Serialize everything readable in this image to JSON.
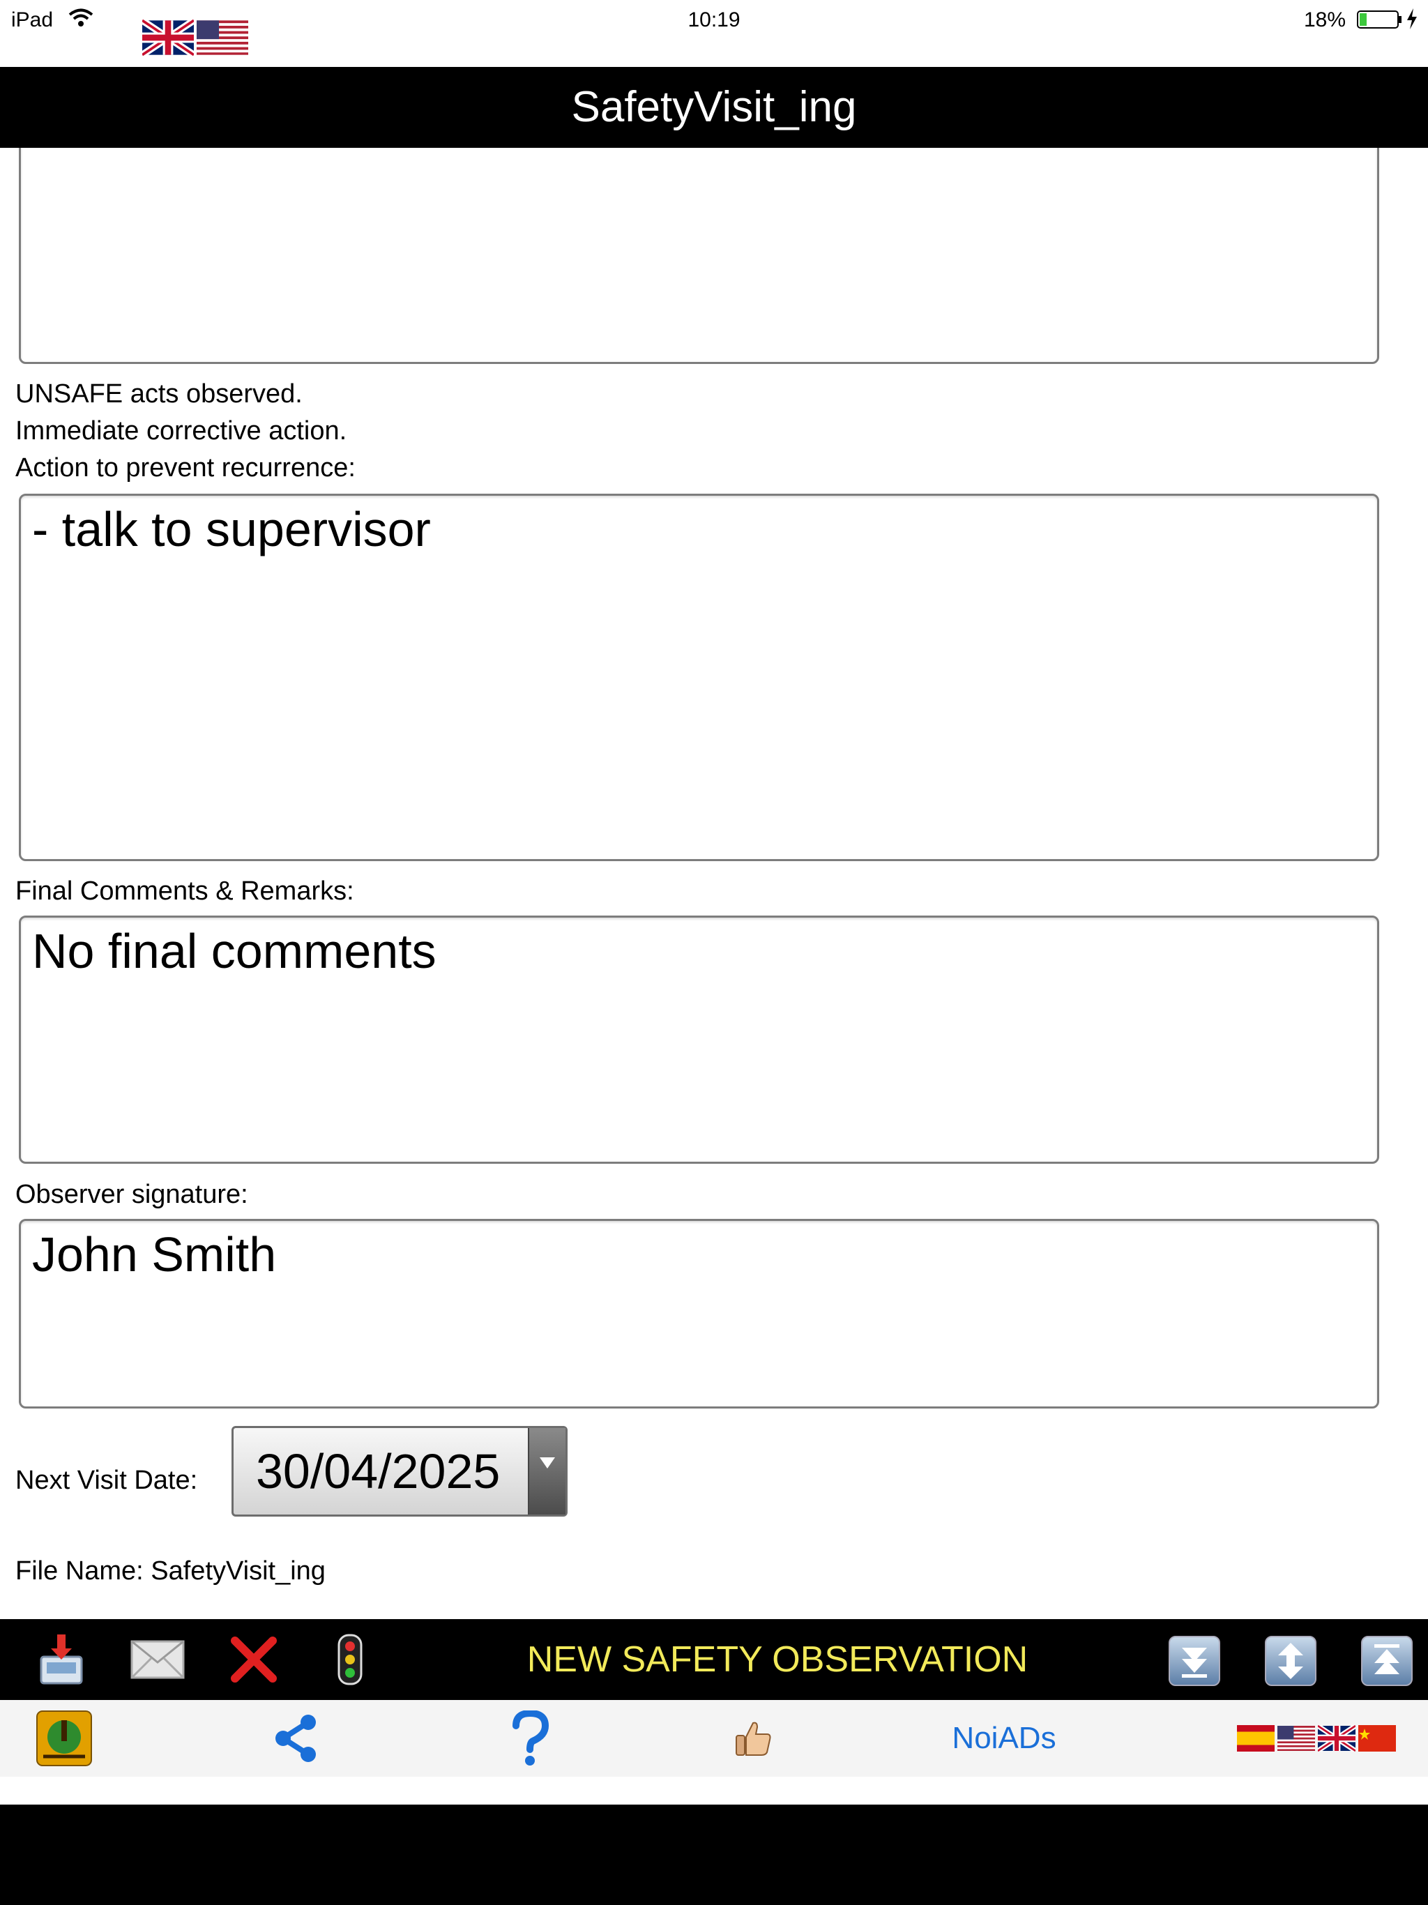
{
  "status_bar": {
    "device": "iPad",
    "time": "10:19",
    "battery": "18%"
  },
  "title": "SafetyVisit_ing",
  "form": {
    "unsafe_acts_label": "UNSAFE acts observed.",
    "immediate_action_label": "Immediate corrective action.",
    "prevent_label": "Action to prevent recurrence:",
    "prevent_value": "- talk to supervisor",
    "final_comments_label": "Final Comments & Remarks:",
    "final_comments_value": "No final comments",
    "signature_label": "Observer signature:",
    "signature_value": "John Smith",
    "next_visit_label": "Next Visit Date:",
    "next_visit_value": "30/04/2025",
    "file_name": "File Name: SafetyVisit_ing"
  },
  "toolbar": {
    "title": "NEW SAFETY OBSERVATION",
    "icons": [
      "save-icon",
      "mail-icon",
      "delete-icon",
      "traffic-light-icon",
      "scroll-bottom-icon",
      "scroll-middle-icon",
      "scroll-top-icon"
    ]
  },
  "tab_bar": {
    "noiads_label": "NoiADs",
    "icons": [
      "app-logo-icon",
      "share-icon",
      "help-icon",
      "thumbs-up-icon",
      "language-flags-icon"
    ]
  },
  "colors": {
    "toolbar_title": "#f2ea5a",
    "link_blue": "#1a6fd8",
    "bar_black": "#000000"
  }
}
